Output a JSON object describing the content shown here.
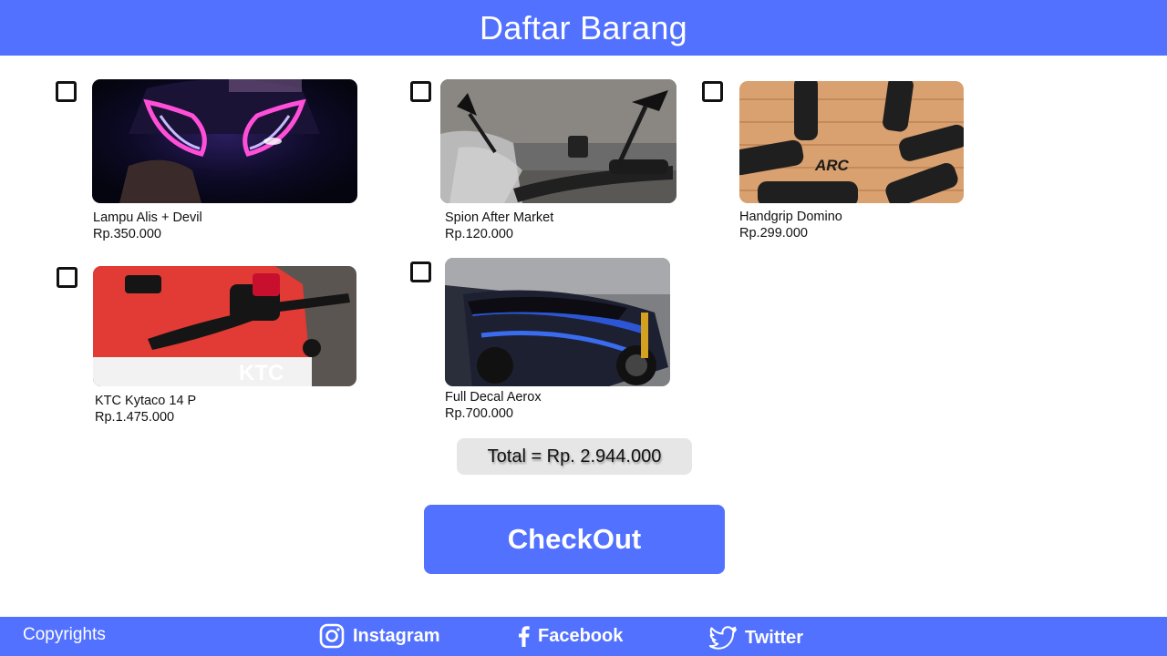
{
  "header": {
    "title": "Daftar Barang"
  },
  "products": [
    {
      "name": "Lampu Alis + Devil",
      "price": "Rp.350.000",
      "checked": false
    },
    {
      "name": "Spion After Market",
      "price": "Rp.120.000",
      "checked": false
    },
    {
      "name": "Handgrip Domino",
      "price": "Rp.299.000",
      "checked": false
    },
    {
      "name": "KTC Kytaco 14 P",
      "price": "Rp.1.475.000",
      "checked": false
    },
    {
      "name": "Full Decal Aerox",
      "price": "Rp.700.000",
      "checked": false
    }
  ],
  "image_text": {
    "arc_brand": "ARC",
    "ktc_brand": "KTC"
  },
  "total": {
    "label": "Total = Rp. 2.944.000"
  },
  "checkout": {
    "label": "CheckOut"
  },
  "footer": {
    "copyright": "Copyrights",
    "instagram": "Instagram",
    "facebook": "Facebook",
    "twitter": "Twitter"
  },
  "colors": {
    "primary": "#5271ff",
    "total_bg": "#e6e6e6",
    "text": "#111111"
  },
  "icons": [
    "instagram-icon",
    "facebook-icon",
    "twitter-icon"
  ]
}
